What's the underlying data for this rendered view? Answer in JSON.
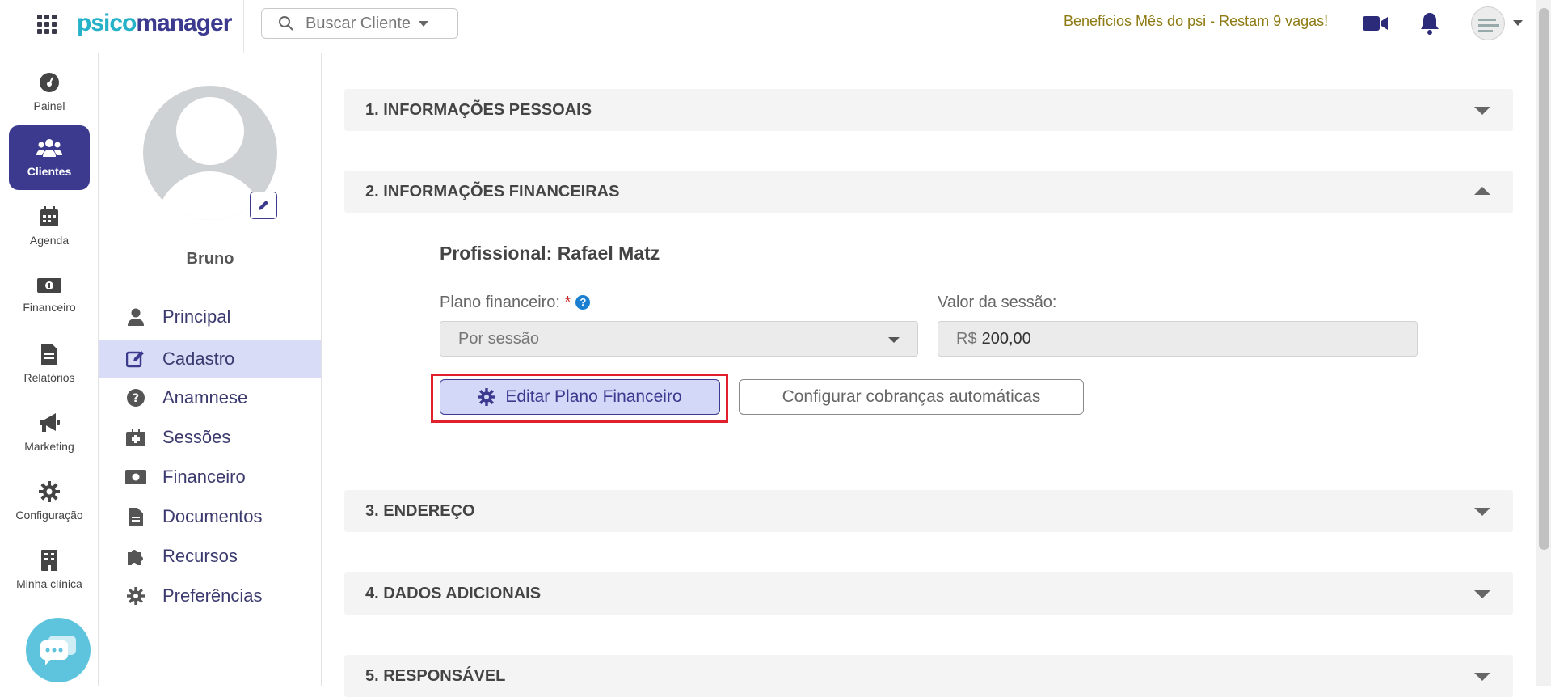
{
  "topbar": {
    "logo_part1": "psico",
    "logo_part2": "manager",
    "search_placeholder": "Buscar Cliente",
    "promo": "Benefícios Mês do psi - Restam 9 vagas!"
  },
  "leftnav": {
    "items": [
      {
        "label": "Painel",
        "icon": "dashboard-icon"
      },
      {
        "label": "Clientes",
        "icon": "users-icon",
        "active": true
      },
      {
        "label": "Agenda",
        "icon": "calendar-icon"
      },
      {
        "label": "Financeiro",
        "icon": "money-icon"
      },
      {
        "label": "Relatórios",
        "icon": "document-icon"
      },
      {
        "label": "Marketing",
        "icon": "megaphone-icon"
      },
      {
        "label": "Configuração",
        "icon": "gear-icon"
      },
      {
        "label": "Minha clínica",
        "icon": "building-icon"
      }
    ]
  },
  "client": {
    "name": "Bruno"
  },
  "subnav": {
    "items": [
      {
        "label": "Principal",
        "icon": "user-icon"
      },
      {
        "label": "Cadastro",
        "icon": "edit-icon",
        "active": true
      },
      {
        "label": "Anamnese",
        "icon": "question-icon"
      },
      {
        "label": "Sessões",
        "icon": "medkit-icon"
      },
      {
        "label": "Financeiro",
        "icon": "money-icon"
      },
      {
        "label": "Documentos",
        "icon": "document-icon"
      },
      {
        "label": "Recursos",
        "icon": "puzzle-icon"
      },
      {
        "label": "Preferências",
        "icon": "gear-icon"
      }
    ]
  },
  "sections": [
    {
      "title": "1. INFORMAÇÕES PESSOAIS",
      "expanded": false
    },
    {
      "title": "2. INFORMAÇÕES FINANCEIRAS",
      "expanded": true
    },
    {
      "title": "3. ENDEREÇO",
      "expanded": false
    },
    {
      "title": "4. DADOS ADICIONAIS",
      "expanded": false
    },
    {
      "title": "5. RESPONSÁVEL",
      "expanded": false
    }
  ],
  "financial": {
    "professional": "Profissional: Rafael Matz",
    "plan_label": "Plano financeiro:",
    "plan_required": "*",
    "help": "?",
    "plan_value": "Por sessão",
    "session_label": "Valor da sessão:",
    "currency": "R$",
    "session_value": "200,00",
    "edit_button": "Editar Plano Financeiro",
    "config_button": "Configurar cobranças automáticas"
  },
  "colors": {
    "brand": "#3b3a8f",
    "accent": "#25b2c9",
    "highlight": "#e0202c",
    "promo": "#8d7a12"
  }
}
